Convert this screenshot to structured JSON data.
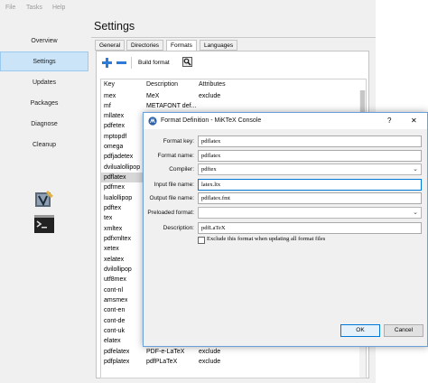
{
  "menu": [
    "File",
    "Tasks",
    "Help"
  ],
  "sidebar": {
    "items": [
      "Overview",
      "Settings",
      "Updates",
      "Packages",
      "Diagnose",
      "Cleanup"
    ],
    "active_index": 1,
    "tool_icons": [
      "tex-editor-icon",
      "terminal-icon"
    ]
  },
  "main": {
    "title": "Settings",
    "tabs": [
      "General",
      "Directories",
      "Formats",
      "Languages"
    ],
    "active_tab": "Formats",
    "toolbar": {
      "add_icon": "plus-icon",
      "remove_icon": "minus-icon",
      "build_label": "Build format",
      "properties_icon": "properties-icon"
    },
    "columns": [
      "Key",
      "Description",
      "Attributes"
    ],
    "rows": [
      [
        "mex",
        "MeX",
        "exclude"
      ],
      [
        "mf",
        "METAFONT def...",
        ""
      ],
      [
        "mllatex",
        "",
        ""
      ],
      [
        "pdfetex",
        "",
        ""
      ],
      [
        "mptopdf",
        "",
        ""
      ],
      [
        "omega",
        "",
        ""
      ],
      [
        "pdfjadetex",
        "",
        ""
      ],
      [
        "dvilualollipop",
        "",
        ""
      ],
      [
        "pdflatex",
        "",
        ""
      ],
      [
        "pdfmex",
        "",
        ""
      ],
      [
        "lualollipop",
        "",
        ""
      ],
      [
        "pdftex",
        "",
        ""
      ],
      [
        "tex",
        "",
        ""
      ],
      [
        "xmltex",
        "",
        ""
      ],
      [
        "pdfxmltex",
        "",
        ""
      ],
      [
        "xetex",
        "",
        ""
      ],
      [
        "xelatex",
        "",
        ""
      ],
      [
        "dvilollipop",
        "",
        ""
      ],
      [
        "utf8mex",
        "",
        ""
      ],
      [
        "cont-nl",
        "",
        ""
      ],
      [
        "amsmex",
        "",
        ""
      ],
      [
        "cont-en",
        "",
        ""
      ],
      [
        "cont-de",
        "",
        ""
      ],
      [
        "cont-uk",
        "",
        ""
      ],
      [
        "elatex",
        "",
        ""
      ],
      [
        "pdfelatex",
        "PDF-e-LaTeX",
        "exclude"
      ],
      [
        "pdfplatex",
        "pdfPLaTeX",
        "exclude"
      ]
    ],
    "selected_index": 8
  },
  "dialog": {
    "title": "Format Definition - MiKTeX Console",
    "help": "?",
    "close": "✕",
    "fields": {
      "format_key": {
        "label": "Format key:",
        "value": "pdflatex"
      },
      "format_name": {
        "label": "Format name:",
        "value": "pdflatex"
      },
      "compiler": {
        "label": "Compiler:",
        "value": "pdftex"
      },
      "input_file": {
        "label": "Input file name:",
        "value": "latex.ltx"
      },
      "output_file": {
        "label": "Output file name:",
        "value": "pdflatex.fmt"
      },
      "preloaded": {
        "label": "Preloaded format:",
        "value": ""
      },
      "description": {
        "label": "Description:",
        "value": "pdfLaTeX"
      }
    },
    "exclude_label": "Exclude this format when updating all format files",
    "ok": "OK",
    "cancel": "Cancel",
    "accent": "#0078d7"
  }
}
